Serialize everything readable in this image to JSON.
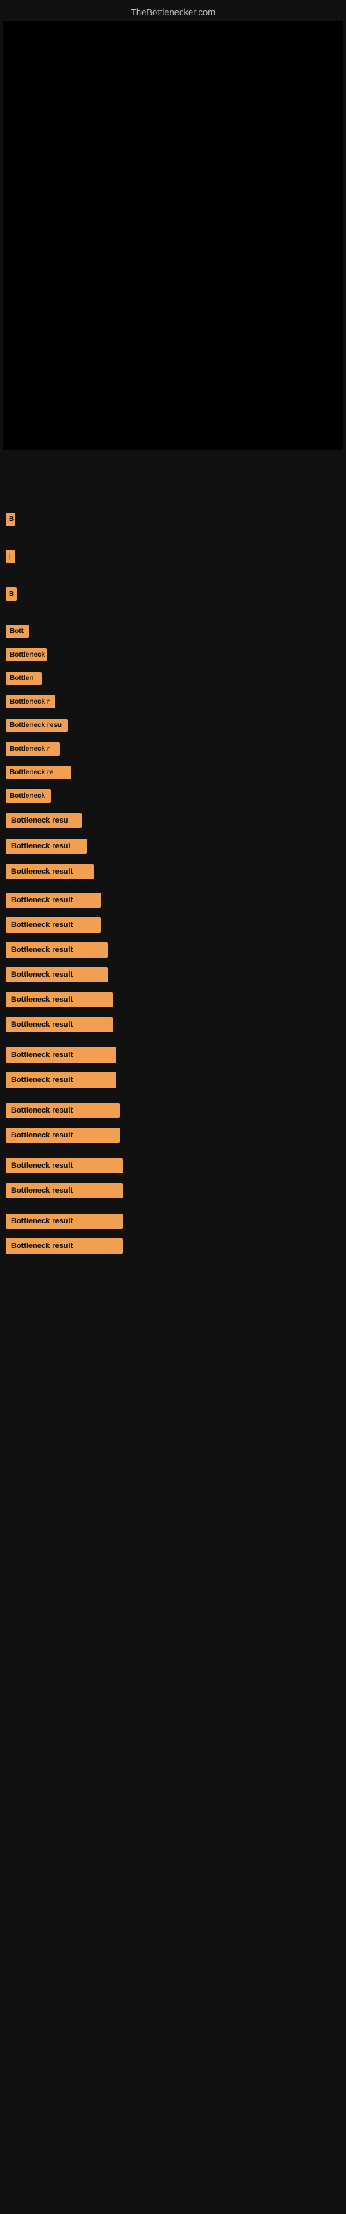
{
  "site": {
    "title": "TheBottlenecker.com"
  },
  "labels": {
    "bottleneck_result": "Bottleneck result"
  },
  "rows": [
    {
      "id": 1,
      "text": "Bottleneck result",
      "width": 170,
      "marginTop": 2354
    },
    {
      "id": 2,
      "text": "Bottleneck result",
      "width": 170,
      "marginTop": 2530
    },
    {
      "id": 3,
      "text": "Bottleneck result",
      "width": 170,
      "marginTop": 2705
    },
    {
      "id": 4,
      "text": "Bottleneck result",
      "width": 170,
      "marginTop": 2796
    },
    {
      "id": 5,
      "text": "Bottleneck result",
      "width": 170,
      "marginTop": 2882
    },
    {
      "id": 6,
      "text": "Bottleneck result",
      "width": 170,
      "marginTop": 2972
    },
    {
      "id": 7,
      "text": "Bottleneck result",
      "width": 170,
      "marginTop": 3059
    },
    {
      "id": 8,
      "text": "Bottleneck result",
      "width": 170,
      "marginTop": 3147
    }
  ],
  "colors": {
    "background": "#111111",
    "label_bg": "#f0a050",
    "label_text": "#1a1a1a",
    "title_text": "#cccccc"
  }
}
